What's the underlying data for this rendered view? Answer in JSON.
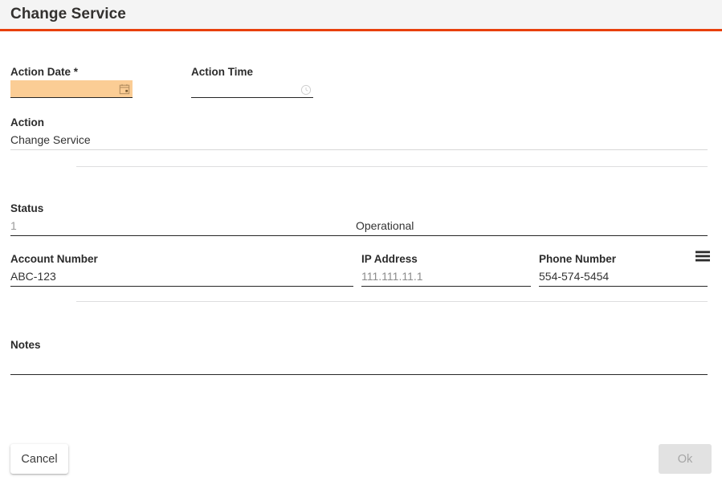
{
  "header": {
    "title": "Change Service",
    "accent_color": "#e8400c",
    "background_color": "#f4f4f4"
  },
  "form": {
    "fields": {
      "action_date": {
        "label": "Action Date *",
        "value": "",
        "icon": "calendar-icon",
        "autofill_color": "#fbcd95"
      },
      "action_time": {
        "label": "Action Time",
        "value": "",
        "icon": "clock-icon"
      },
      "action": {
        "label": "Action",
        "value": "Change Service"
      },
      "status": {
        "label": "Status",
        "code": "1",
        "value": "Operational",
        "icon": "list-menu-icon"
      },
      "account_number": {
        "label": "Account Number",
        "value": "ABC-123"
      },
      "ip_address": {
        "label": "IP Address",
        "value": "111.111.11.1"
      },
      "phone_number": {
        "label": "Phone Number",
        "value": "554-574-5454"
      },
      "notes": {
        "label": "Notes",
        "value": ""
      }
    }
  },
  "footer": {
    "cancel_label": "Cancel",
    "ok_label": "Ok",
    "ok_disabled": true
  }
}
